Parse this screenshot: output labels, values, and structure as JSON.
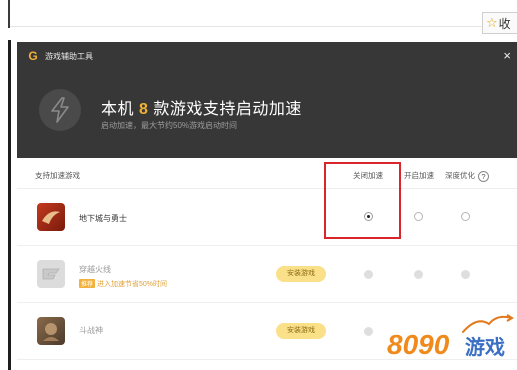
{
  "browser": {
    "bookmark_label": "收"
  },
  "dialog": {
    "title": "游戏辅助工具",
    "close_glyph": "×",
    "hero": {
      "title_prefix": "本机",
      "count": "8",
      "title_suffix": "款游戏支持启动加速",
      "subtitle": "启动加速，最大节约50%游戏启动时间"
    },
    "columns": {
      "game": "支持加速游戏",
      "close_accel": "关闭加速",
      "open_accel": "开启加速",
      "deep_opt": "深度优化"
    },
    "games": [
      {
        "name": "地下城与勇士",
        "install_label": "",
        "tag_badge": "",
        "tag_text": "",
        "state": "close"
      },
      {
        "name": "穿越火线",
        "install_label": "安装游戏",
        "tag_badge": "推荐",
        "tag_text": "进入加速节省50%时间",
        "state": "disabled"
      },
      {
        "name": "斗战神",
        "install_label": "安装游戏",
        "tag_badge": "",
        "tag_text": "",
        "state": "disabled"
      }
    ]
  },
  "watermark": {
    "digits": "8090",
    "text": "游戏"
  },
  "colors": {
    "header_bg": "#373737",
    "accent": "#f2b134",
    "highlight": "#d8262a"
  }
}
